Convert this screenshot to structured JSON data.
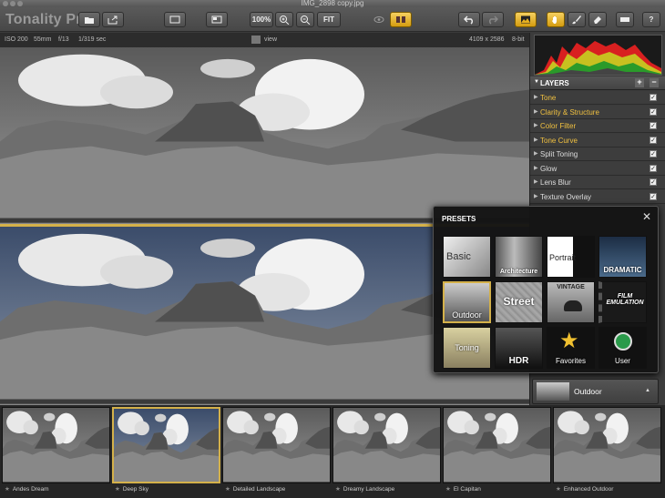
{
  "window": {
    "title": "IMG_2898 copy.jpg"
  },
  "toolbar": {
    "app_name": "Tonality Pro",
    "zoom": "100%",
    "fit": "FIT"
  },
  "info": {
    "iso": "ISO 200",
    "focal": "55mm",
    "aperture": "f/13",
    "shutter": "1/319 sec",
    "view": "view",
    "dimensions": "4109 x 2586",
    "bitdepth": "8-bit"
  },
  "layers": {
    "title": "LAYERS",
    "items": [
      {
        "label": "Tone",
        "highlight": true
      },
      {
        "label": "Clarity & Structure",
        "highlight": true
      },
      {
        "label": "Color Filter",
        "highlight": true
      },
      {
        "label": "Tone Curve",
        "highlight": true
      },
      {
        "label": "Split Toning",
        "highlight": false
      },
      {
        "label": "Glow",
        "highlight": false
      },
      {
        "label": "Lens Blur",
        "highlight": false
      },
      {
        "label": "Texture Overlay",
        "highlight": false
      }
    ]
  },
  "presets": {
    "title": "PRESETS",
    "tiles": [
      "Basic",
      "Architecture",
      "Portrait",
      "DRAMATIC",
      "Outdoor",
      "Street",
      "VINTAGE",
      "FILM EMULATION",
      "Toning",
      "HDR",
      "Favorites",
      "User"
    ]
  },
  "current_preset": "Outdoor",
  "filmstrip": [
    "Andes Dream",
    "Deep Sky",
    "Detailed Landscape",
    "Dreamy Landscape",
    "El Capitan",
    "Enhanced Outdoor"
  ],
  "colors": {
    "accent": "#d4b14a",
    "highlight_text": "#f0c040"
  }
}
